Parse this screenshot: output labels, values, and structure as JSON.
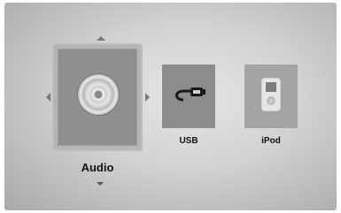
{
  "menu": {
    "items": [
      {
        "label": "Audio",
        "icon": "disc-icon",
        "selected": true
      },
      {
        "label": "USB",
        "icon": "usb-cable-icon",
        "selected": false
      },
      {
        "label": "iPod",
        "icon": "ipod-icon",
        "selected": false
      }
    ]
  },
  "colors": {
    "background": "#d2d2d2",
    "focus_frame": "#bdbdbd",
    "tile": "#8f8f8f",
    "text": "#111111"
  }
}
